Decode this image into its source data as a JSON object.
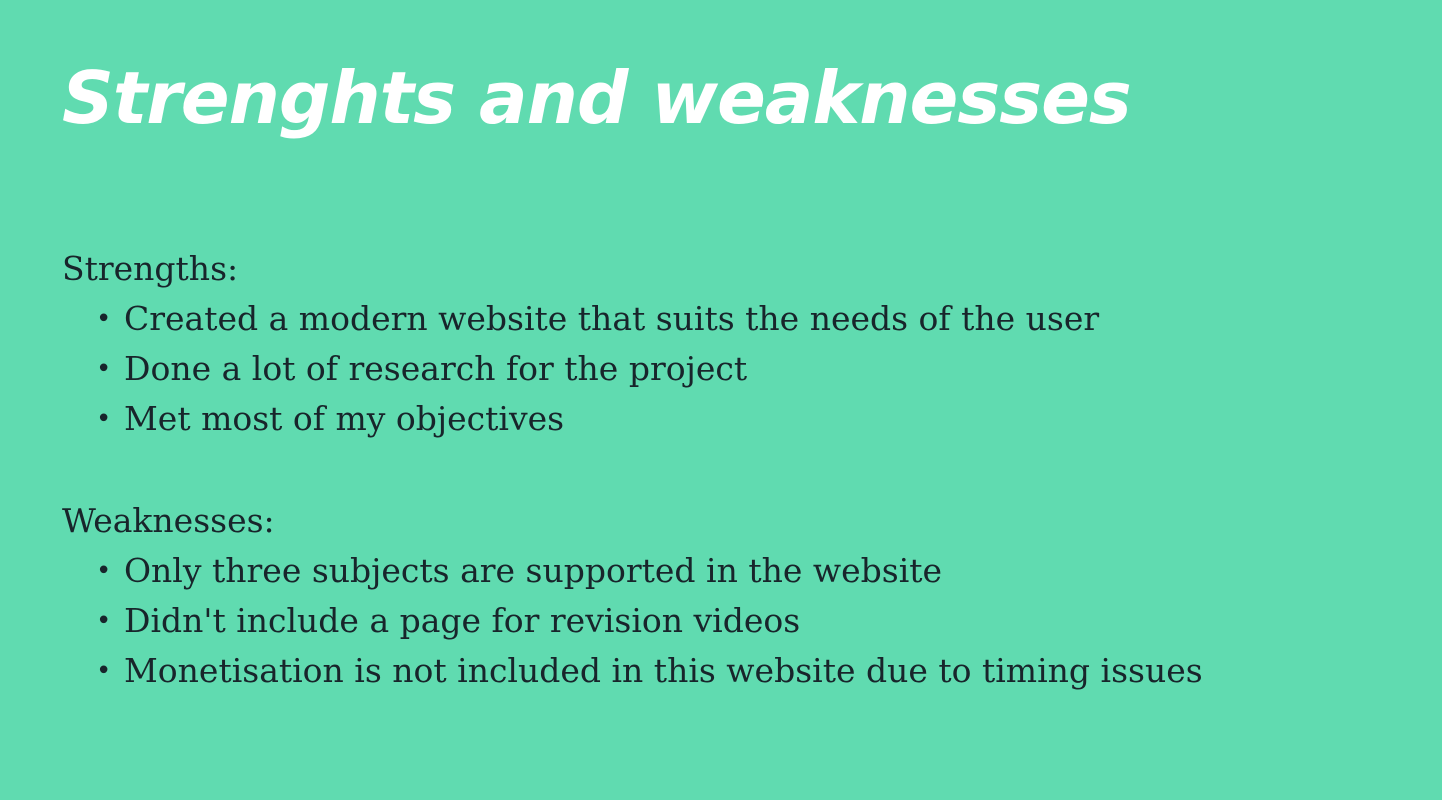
{
  "slide": {
    "title": "Strenghts and weaknesses",
    "background_color": "#60dbb0",
    "text_color": "#18252b",
    "title_color": "#ffffff",
    "strengths": {
      "heading": "Strengths:",
      "items": [
        "Created a modern website that suits the needs of the user",
        "Done a lot of research for the project",
        "Met most of my objectives"
      ]
    },
    "weaknesses": {
      "heading": "Weaknesses:",
      "items": [
        "Only three subjects are supported in the website",
        "Didn't include a page for revision videos",
        "Monetisation is not included in this website due to timing issues"
      ]
    },
    "bullet_glyph": "•"
  }
}
